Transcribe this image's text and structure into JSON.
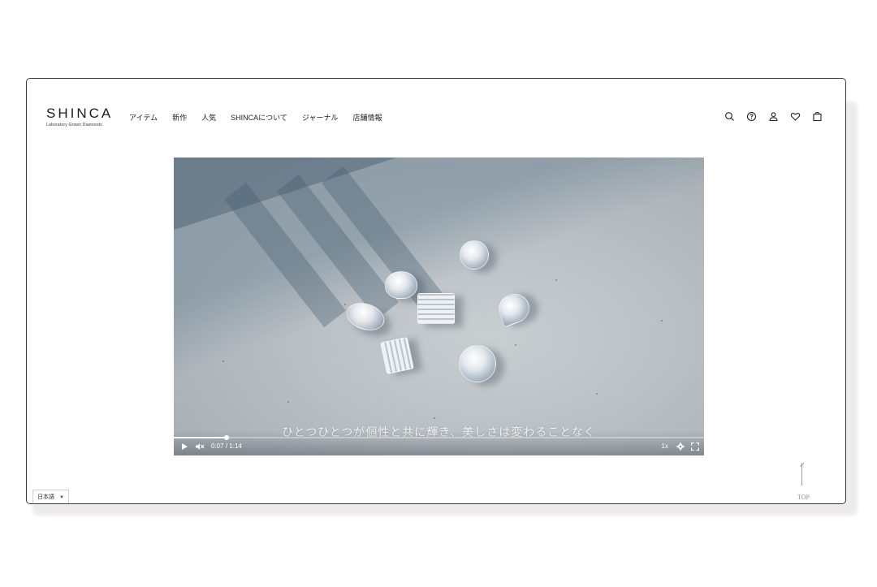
{
  "header": {
    "logo": "SHINCA",
    "logo_sub": "Laboratory Grown Diamonds",
    "nav": [
      "アイテム",
      "新作",
      "人気",
      "SHINCAについて",
      "ジャーナル",
      "店舗情報"
    ],
    "icons": [
      "search-icon",
      "help-icon",
      "account-icon",
      "heart-icon",
      "bag-icon"
    ]
  },
  "video": {
    "subtitle": "ひとつひとつが個性と共に輝き、美しさは変わることなく",
    "current_time": "0:07",
    "separator": "/",
    "duration": "1:14",
    "progress_fraction": 0.1,
    "speed": "1x",
    "muted": true
  },
  "footer": {
    "language": "日本語",
    "language_arrow": "▼",
    "top_label": "TOP"
  },
  "colors": {
    "frame_border": "#3a3a3a",
    "text": "#222222"
  }
}
